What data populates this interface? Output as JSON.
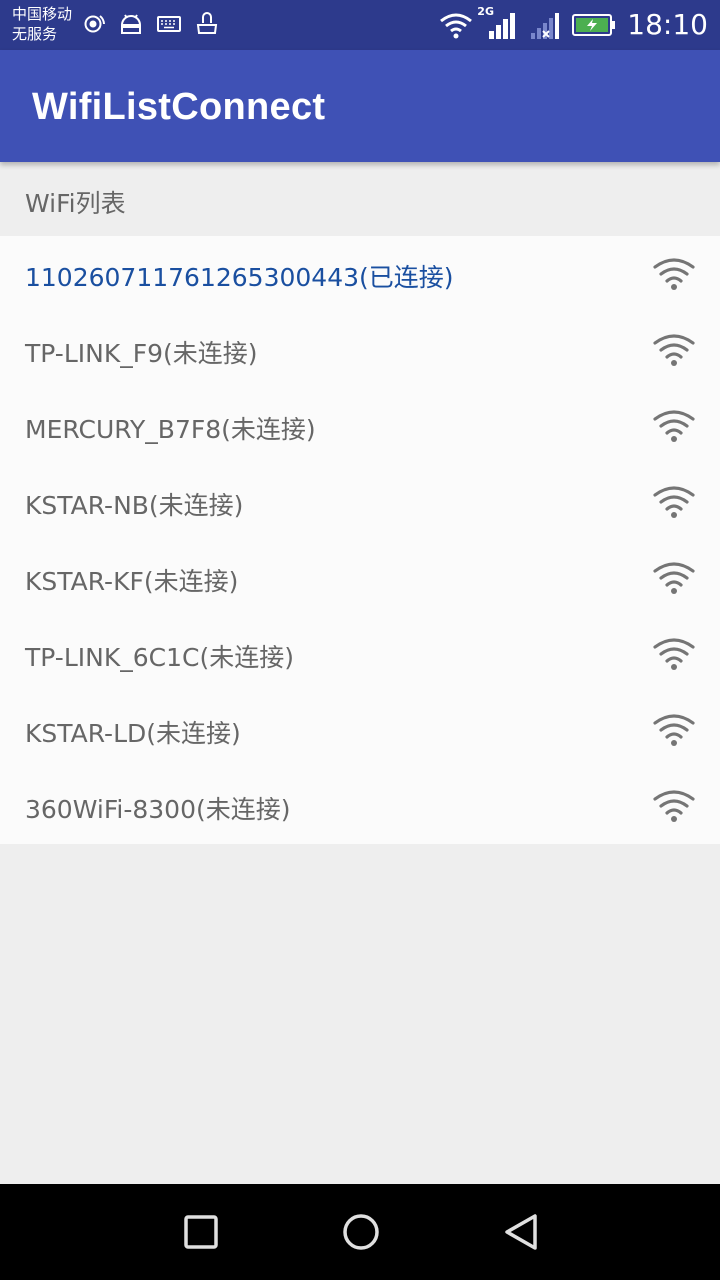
{
  "status_bar": {
    "carrier_line1": "中国移动",
    "carrier_line2": "无服务",
    "network_type": "2G",
    "time": "18:10",
    "icons": [
      "hotspot-icon",
      "android-debug-icon",
      "keyboard-icon",
      "notification-icon",
      "wifi-icon",
      "signal-2g-icon",
      "signal-no-service-icon",
      "battery-charging-icon"
    ]
  },
  "app_bar": {
    "title": "WifiListConnect"
  },
  "section": {
    "title": "WiFi列表"
  },
  "wifi_list": [
    {
      "name": "110260711761265300443(已连接)",
      "connected": true,
      "icon": "wifi-signal-icon"
    },
    {
      "name": "TP-LINK_F9(未连接)",
      "connected": false,
      "icon": "wifi-signal-icon"
    },
    {
      "name": "MERCURY_B7F8(未连接)",
      "connected": false,
      "icon": "wifi-signal-icon"
    },
    {
      "name": "KSTAR-NB(未连接)",
      "connected": false,
      "icon": "wifi-signal-icon"
    },
    {
      "name": "KSTAR-KF(未连接)",
      "connected": false,
      "icon": "wifi-signal-icon"
    },
    {
      "name": "TP-LINK_6C1C(未连接)",
      "connected": false,
      "icon": "wifi-signal-icon"
    },
    {
      "name": "KSTAR-LD(未连接)",
      "connected": false,
      "icon": "wifi-signal-icon"
    },
    {
      "name": "360WiFi-8300(未连接)",
      "connected": false,
      "icon": "wifi-signal-icon"
    }
  ],
  "nav_bar": {
    "buttons": [
      "recents-square-icon",
      "home-circle-icon",
      "back-triangle-icon"
    ]
  },
  "colors": {
    "status_bar": "#2d3a8c",
    "app_bar": "#3f51b5",
    "connected_text": "#1a4fa0",
    "list_text": "#666666",
    "list_background": "#fbfbfb",
    "page_background": "#eeeeee"
  }
}
